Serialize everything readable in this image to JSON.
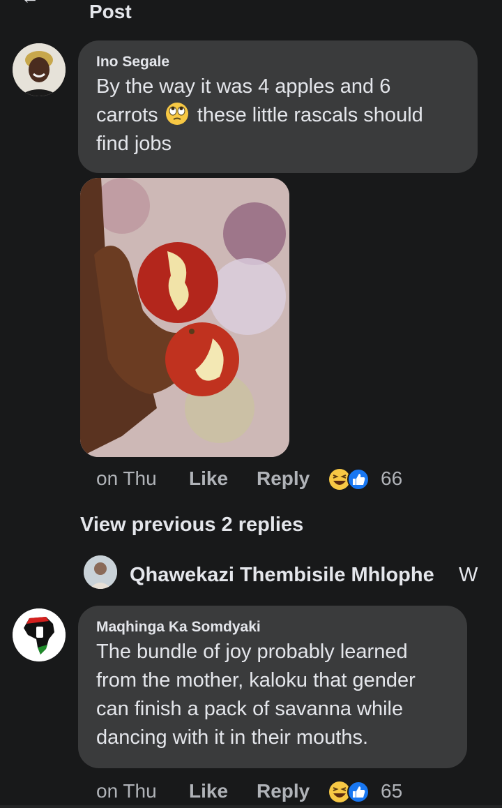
{
  "header": {
    "title": "Post"
  },
  "comments": [
    {
      "author": "Ino Segale",
      "text_parts": [
        "By the way it was 4 apples and 6",
        "carrots",
        "these little rascals should",
        "find jobs"
      ],
      "inline_emoji": "face-with-rolling-eyes",
      "time": "on Thu",
      "like_label": "Like",
      "reply_label": "Reply",
      "reaction_icons": [
        "haha-icon",
        "like-icon"
      ],
      "reaction_count": "66"
    },
    {
      "author": "Maqhinga Ka Somdyaki",
      "text_lines": [
        "The bundle of joy probably learned",
        "from the mother, kaloku that gender",
        "can finish a pack of savanna while",
        "dancing with it in their mouths."
      ],
      "time": "on Thu",
      "like_label": "Like",
      "reply_label": "Reply",
      "reaction_icons": [
        "haha-icon",
        "like-icon"
      ],
      "reaction_count": "65"
    }
  ],
  "view_previous": "View previous 2 replies",
  "reply_preview": {
    "name": "Qhawekazi Thembisile Mhlophe",
    "trail": "W"
  },
  "colors": {
    "background": "#18191a",
    "bubble": "#3a3b3c",
    "text": "#e4e6eb",
    "meta": "#b0b3b8",
    "like_blue": "#1877f2",
    "haha_yellow": "#f7c844"
  }
}
